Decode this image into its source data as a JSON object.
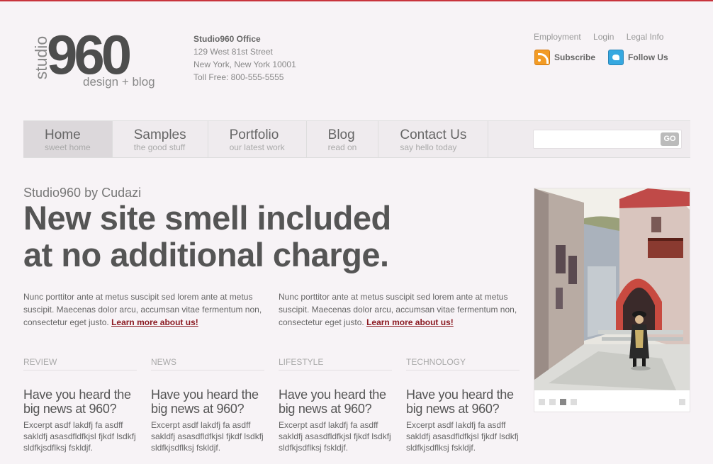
{
  "brand": {
    "logo_studio": "studio",
    "logo_number": "960",
    "logo_tagline": "design + blog"
  },
  "office": {
    "title": "Studio960 Office",
    "street": "129 West 81st Street",
    "city": "New York, New York 10001",
    "phone": "Toll Free: 800-555-5555"
  },
  "toplinks": [
    "Employment",
    "Login",
    "Legal Info"
  ],
  "social": {
    "subscribe": "Subscribe",
    "follow": "Follow Us"
  },
  "nav": [
    {
      "label": "Home",
      "sub": "sweet home"
    },
    {
      "label": "Samples",
      "sub": "the good stuff"
    },
    {
      "label": "Portfolio",
      "sub": "our latest work"
    },
    {
      "label": "Blog",
      "sub": "read on"
    },
    {
      "label": "Contact Us",
      "sub": "say hello today"
    }
  ],
  "search": {
    "placeholder": "",
    "button": "GO"
  },
  "hero": {
    "byline": "Studio960 by Cudazi",
    "headline_line1": "New site smell included",
    "headline_line2": "at no additional charge."
  },
  "intro": [
    {
      "text": "Nunc porttitor ante at metus suscipit sed lorem ante at metus suscipit. Maecenas dolor arcu, accumsan vitae fermentum non, consectetur eget justo. ",
      "link": "Learn more about us!"
    },
    {
      "text": "Nunc porttitor ante at metus suscipit sed lorem ante at metus suscipit. Maecenas dolor arcu, accumsan vitae fermentum non, consectetur eget justo. ",
      "link": "Learn more about us!"
    }
  ],
  "categories": [
    {
      "name": "REVIEW",
      "title": "Have you heard the big news at 960?",
      "excerpt": "Excerpt asdf lakdfj fa asdff sakldfj asasdfldfkjsl fjkdf lsdkfj sldfkjsdflksj fskldjf."
    },
    {
      "name": "NEWS",
      "title": "Have you heard the big news at 960?",
      "excerpt": "Excerpt asdf lakdfj fa asdff sakldfj asasdfldfkjsl fjkdf lsdkfj sldfkjsdflksj fskldjf."
    },
    {
      "name": "LIFESTYLE",
      "title": "Have you heard the big news at 960?",
      "excerpt": "Excerpt asdf lakdfj fa asdff sakldfj asasdfldfkjsl fjkdf lsdkfj sldfkjsdflksj fskldjf."
    },
    {
      "name": "TECHNOLOGY",
      "title": "Have you heard the big news at 960?",
      "excerpt": "Excerpt asdf lakdfj fa asdff sakldfj asasdfldfkjsl fjkdf lsdkfj sldfkjsdflksj fskldjf."
    }
  ],
  "slideshow": {
    "active_index": 2,
    "slide_count": 4
  },
  "colors": {
    "accent": "#c8343c",
    "link": "#8b1a22",
    "background": "#f7f3f6"
  }
}
